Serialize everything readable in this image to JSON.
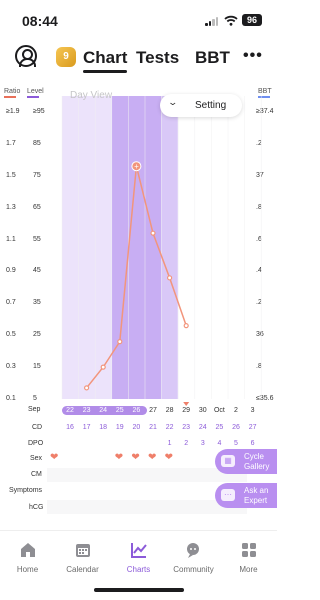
{
  "status_bar": {
    "time": "08:44",
    "battery": "96"
  },
  "header": {
    "badge": "9",
    "tabs": [
      {
        "label": "Chart",
        "active": true
      },
      {
        "label": "Tests",
        "active": false
      },
      {
        "label": "BBT",
        "active": false
      }
    ],
    "more": "•••"
  },
  "chart": {
    "ratio_label": "Ratio",
    "level_label": "Level",
    "bbt_label": "BBT",
    "day_view": "Day View",
    "setting": "Setting",
    "ratio_ticks": [
      "≥1.9",
      "1.7",
      "1.5",
      "1.3",
      "1.1",
      "0.9",
      "0.7",
      "0.5",
      "0.3",
      "0.1"
    ],
    "level_ticks": [
      "≥95",
      "85",
      "75",
      "65",
      "55",
      "45",
      "35",
      "25",
      "15",
      "5"
    ],
    "bbt_ticks": [
      "≥37.4",
      ".2",
      "37",
      ".8",
      ".6",
      ".4",
      ".2",
      "36",
      ".8",
      "≤35.6"
    ]
  },
  "chart_data": {
    "type": "line",
    "x": [
      17,
      18,
      19,
      20,
      21,
      22,
      23
    ],
    "x_unit": "CD",
    "values": [
      8.5,
      15,
      23,
      78,
      57,
      43,
      28
    ],
    "ylabel": "Level",
    "ylim": [
      0,
      100
    ],
    "peak_index": 3,
    "shaded_cd_range": [
      16,
      22
    ],
    "highlight_cd_range": [
      19,
      21
    ],
    "color": "#f2957c"
  },
  "rows": {
    "month_label": "Sep",
    "month2_label": "Oct",
    "dates": [
      "22",
      "23",
      "24",
      "25",
      "26",
      "27",
      "28",
      "29",
      "30",
      "Oct",
      "2",
      "3"
    ],
    "cd_label": "CD",
    "cd": [
      "16",
      "17",
      "18",
      "19",
      "20",
      "21",
      "22",
      "23",
      "24",
      "25",
      "26",
      "27"
    ],
    "dpo_label": "DPO",
    "dpo": [
      "1",
      "2",
      "3",
      "4",
      "5",
      "6"
    ],
    "sex_label": "Sex",
    "cm_label": "CM",
    "symptoms_label": "Symptoms",
    "hcg_label": "hCG"
  },
  "side_buttons": {
    "gallery_line1": "Cycle",
    "gallery_line2": "Gallery",
    "expert_line1": "Ask an",
    "expert_line2": "Expert"
  },
  "nav": [
    {
      "label": "Home",
      "icon": "home-icon",
      "active": false
    },
    {
      "label": "Calendar",
      "icon": "calendar-icon",
      "active": false
    },
    {
      "label": "Charts",
      "icon": "charts-icon",
      "active": true
    },
    {
      "label": "Community",
      "icon": "community-icon",
      "active": false
    },
    {
      "label": "More",
      "icon": "more-grid-icon",
      "active": false
    }
  ],
  "colors": {
    "accent": "#8c5bd9",
    "line": "#f2957c",
    "shade": "#ece3fb",
    "highlight": "#c8aef3"
  }
}
